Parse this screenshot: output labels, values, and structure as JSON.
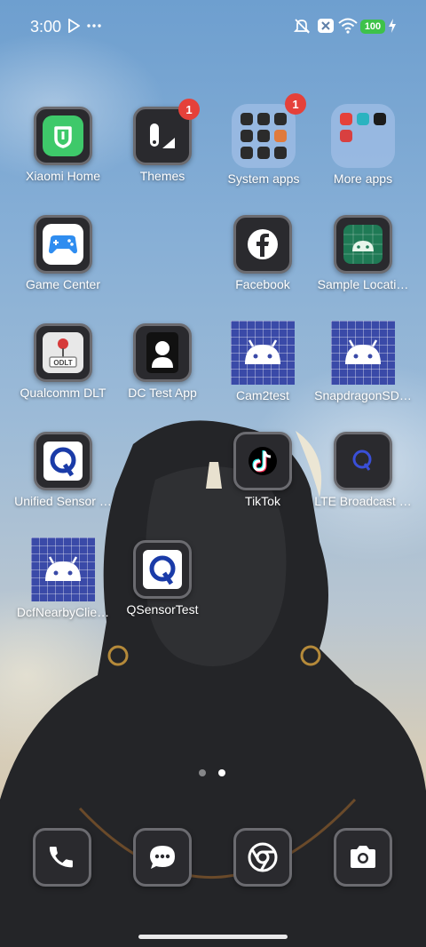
{
  "status_bar": {
    "time": "3:00",
    "battery": "100",
    "icons": [
      "play-store-notification-icon",
      "more-notifications-icon",
      "mute-icon",
      "close-box-icon",
      "wifi-icon",
      "battery-icon",
      "charging-icon"
    ]
  },
  "apps": {
    "xiaomi_home": "Xiaomi Home",
    "themes": "Themes",
    "themes_badge": "1",
    "system_apps": "System apps",
    "system_apps_badge": "1",
    "more_apps": "More apps",
    "game_center": "Game Center",
    "facebook": "Facebook",
    "sample_location": "Sample Locati…",
    "qualcomm_dlt": "Qualcomm DLT",
    "dc_test_app": "DC Test App",
    "cam2test": "Cam2test",
    "snapdragon_sd": "SnapdragonSD…",
    "unified_sensor": "Unified Sensor …",
    "tiktok": "TikTok",
    "lte_broadcast": "LTE Broadcast …",
    "dcf_nearby": "DcfNearbyClie…",
    "qsensor_test": "QSensorTest"
  },
  "page_indicator": {
    "pages": 2,
    "current": 2
  },
  "dock": [
    "phone-icon",
    "messages-icon",
    "chrome-icon",
    "camera-icon"
  ],
  "colors": {
    "badge": "#e5413a",
    "battery": "#3ec24a",
    "folder": "#a0bee6"
  }
}
